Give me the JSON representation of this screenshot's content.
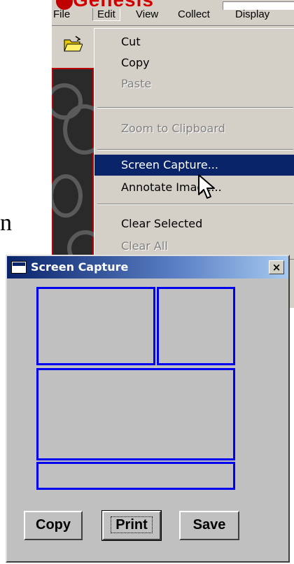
{
  "app": {
    "logo_text": "Genesis",
    "menu": [
      "File",
      "Edit",
      "View",
      "Collect",
      "Display"
    ]
  },
  "edit_menu": {
    "items": [
      {
        "label": "Cut",
        "state": "enabled"
      },
      {
        "label": "Copy",
        "state": "enabled"
      },
      {
        "label": "Paste",
        "state": "disabled"
      },
      {
        "label": "Zoom to Clipboard",
        "state": "disabled"
      },
      {
        "label": "Screen Capture...",
        "state": "selected"
      },
      {
        "label": "Annotate Image...",
        "state": "enabled"
      },
      {
        "label": "Clear Selected",
        "state": "enabled"
      },
      {
        "label": "Clear All",
        "state": "disabled"
      }
    ]
  },
  "page_fragment": "n",
  "dialog": {
    "title": "Screen Capture",
    "close_label": "×",
    "buttons": {
      "copy": "Copy",
      "print": "Print",
      "save": "Save"
    },
    "region_color": "#0000ee"
  },
  "colors": {
    "menu_highlight": "#0a246a",
    "logo": "#d40000",
    "title_gradient_start": "#0a246a"
  }
}
